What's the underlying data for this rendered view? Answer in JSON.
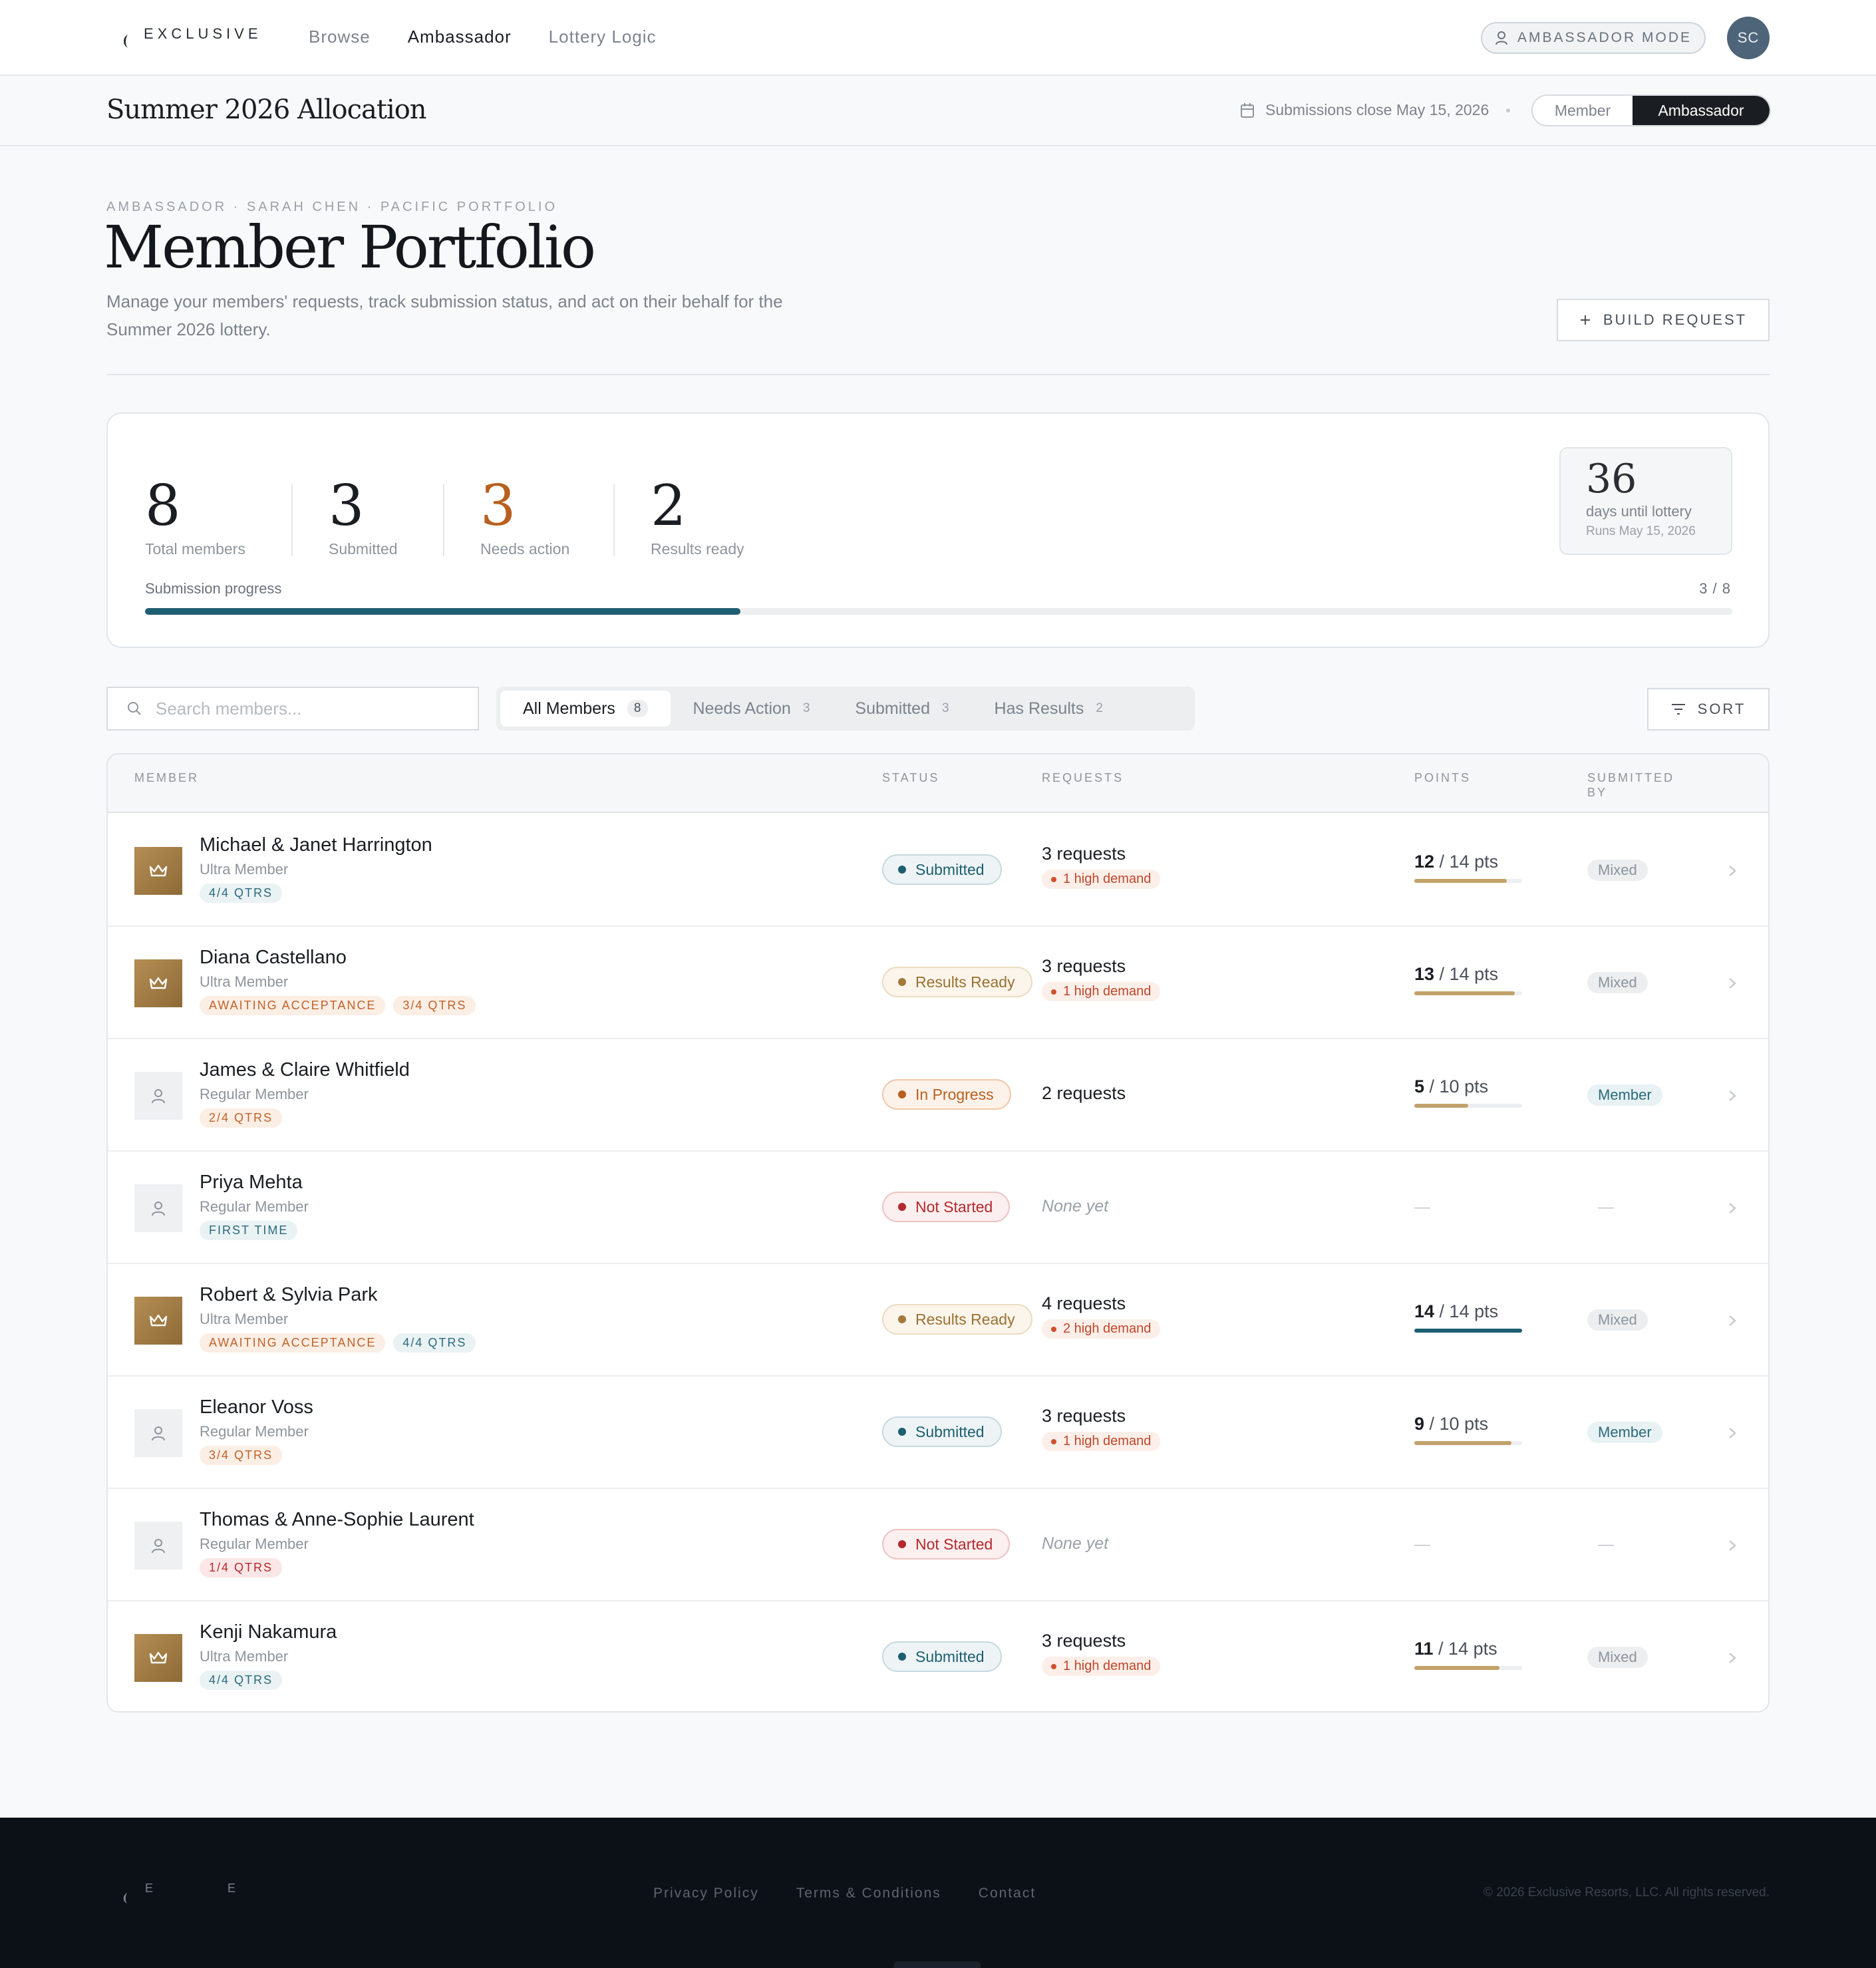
{
  "nav": {
    "brand": "EXCLUSIVE",
    "links": [
      "Browse",
      "Ambassador",
      "Lottery Logic"
    ],
    "active_index": 1,
    "mode_pill": "AMBASSADOR MODE",
    "avatar_initials": "SC"
  },
  "subheader": {
    "title": "Summer 2026 Allocation",
    "close_text": "Submissions close May 15, 2026",
    "toggle": [
      "Member",
      "Ambassador"
    ],
    "toggle_active": "Ambassador"
  },
  "heading": {
    "eyebrow": "AMBASSADOR · SARAH CHEN · PACIFIC PORTFOLIO",
    "title": "Member Portfolio",
    "description": "Manage your members' requests, track submission status, and act on their behalf for the Summer 2026 lottery.",
    "build_button": "BUILD REQUEST"
  },
  "stats": {
    "items": [
      {
        "value": "8",
        "label": "Total members"
      },
      {
        "value": "3",
        "label": "Submitted"
      },
      {
        "value": "3",
        "label": "Needs action"
      },
      {
        "value": "2",
        "label": "Results ready"
      }
    ],
    "countdown": {
      "value": "36",
      "label": "days until lottery",
      "sub": "Runs May 15, 2026"
    },
    "progress": {
      "label": "Submission progress",
      "count_text": "3 / 8",
      "fraction": 0.375
    }
  },
  "filters": {
    "search_placeholder": "Search members...",
    "tabs": [
      {
        "label": "All Members",
        "count": "8"
      },
      {
        "label": "Needs Action",
        "count": "3"
      },
      {
        "label": "Submitted",
        "count": "3"
      },
      {
        "label": "Has Results",
        "count": "2"
      }
    ],
    "active_tab": 0,
    "sort_label": "SORT"
  },
  "table": {
    "headers": {
      "member": "MEMBER",
      "status": "STATUS",
      "requests": "REQUESTS",
      "points": "POINTS",
      "submitted_by": "SUBMITTED BY"
    },
    "rows": [
      {
        "name": "Michael & Janet Harrington",
        "tier": "Ultra Member",
        "ultra": true,
        "tags": [
          {
            "text": "4/4 QTRS",
            "tone": "blue"
          }
        ],
        "status": "Submitted",
        "status_kind": "submitted",
        "requests": "3 requests",
        "high_demand": "1 high demand",
        "points_current": "12",
        "points_total": " / 14 pts",
        "points_fraction": 0.857,
        "submitted_by": "Mixed"
      },
      {
        "name": "Diana Castellano",
        "tier": "Ultra Member",
        "ultra": true,
        "tags": [
          {
            "text": "AWAITING ACCEPTANCE",
            "tone": "orange"
          },
          {
            "text": "3/4 QTRS",
            "tone": "orange"
          }
        ],
        "status": "Results Ready",
        "status_kind": "results",
        "requests": "3 requests",
        "high_demand": "1 high demand",
        "points_current": "13",
        "points_total": " / 14 pts",
        "points_fraction": 0.929,
        "submitted_by": "Mixed"
      },
      {
        "name": "James & Claire Whitfield",
        "tier": "Regular Member",
        "ultra": false,
        "tags": [
          {
            "text": "2/4 QTRS",
            "tone": "orange"
          }
        ],
        "status": "In Progress",
        "status_kind": "progress",
        "requests": "2 requests",
        "high_demand": "",
        "points_current": "5",
        "points_total": " / 10 pts",
        "points_fraction": 0.5,
        "submitted_by": "Member"
      },
      {
        "name": "Priya Mehta",
        "tier": "Regular Member",
        "ultra": false,
        "tags": [
          {
            "text": "FIRST TIME",
            "tone": "blue"
          }
        ],
        "status": "Not Started",
        "status_kind": "notstarted",
        "requests": "None yet",
        "high_demand": "",
        "points_current": "",
        "points_total": "",
        "points_fraction": 0,
        "submitted_by": ""
      },
      {
        "name": "Robert & Sylvia Park",
        "tier": "Ultra Member",
        "ultra": true,
        "tags": [
          {
            "text": "AWAITING ACCEPTANCE",
            "tone": "orange"
          },
          {
            "text": "4/4 QTRS",
            "tone": "blue"
          }
        ],
        "status": "Results Ready",
        "status_kind": "results",
        "requests": "4 requests",
        "high_demand": "2 high demand",
        "points_current": "14",
        "points_total": " / 14 pts",
        "points_fraction": 1.0,
        "submitted_by": "Mixed"
      },
      {
        "name": "Eleanor Voss",
        "tier": "Regular Member",
        "ultra": false,
        "tags": [
          {
            "text": "3/4 QTRS",
            "tone": "orange"
          }
        ],
        "status": "Submitted",
        "status_kind": "submitted",
        "requests": "3 requests",
        "high_demand": "1 high demand",
        "points_current": "9",
        "points_total": " / 10 pts",
        "points_fraction": 0.9,
        "submitted_by": "Member"
      },
      {
        "name": "Thomas & Anne-Sophie Laurent",
        "tier": "Regular Member",
        "ultra": false,
        "tags": [
          {
            "text": "1/4 QTRS",
            "tone": "red"
          }
        ],
        "status": "Not Started",
        "status_kind": "notstarted",
        "requests": "None yet",
        "high_demand": "",
        "points_current": "",
        "points_total": "",
        "points_fraction": 0,
        "submitted_by": ""
      },
      {
        "name": "Kenji Nakamura",
        "tier": "Ultra Member",
        "ultra": true,
        "tags": [
          {
            "text": "4/4 QTRS",
            "tone": "blue"
          }
        ],
        "status": "Submitted",
        "status_kind": "submitted",
        "requests": "3 requests",
        "high_demand": "1 high demand",
        "points_current": "11",
        "points_total": " / 14 pts",
        "points_fraction": 0.786,
        "submitted_by": "Mixed"
      }
    ],
    "empty_dash": "—"
  },
  "footer": {
    "logo_letters": [
      "E",
      "E"
    ],
    "links": [
      "Privacy Policy",
      "Terms & Conditions",
      "Contact"
    ],
    "copyright": "© 2026 Exclusive Resorts, LLC. All rights reserved."
  },
  "colors": {
    "accent_teal": "#1d5f70",
    "needs_action_orange": "#b8601f",
    "gold": "#a47a3a",
    "danger_red": "#b3292d",
    "footer_bg": "#0c1017"
  }
}
